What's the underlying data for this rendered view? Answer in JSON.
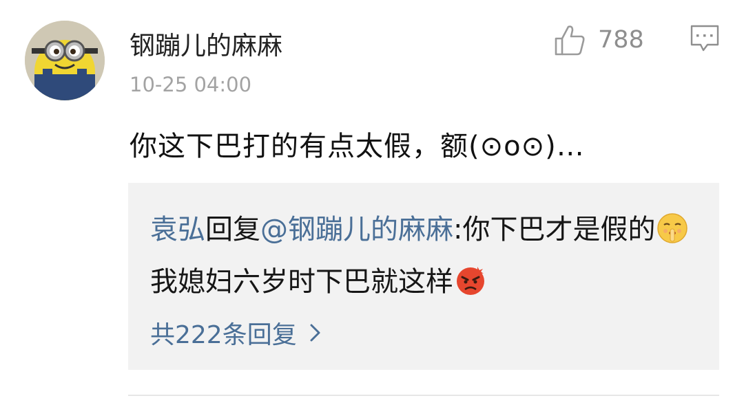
{
  "comment": {
    "username": "钢蹦儿的麻麻",
    "timestamp": "10-25 04:00",
    "like_count": "788",
    "text": "你这下巴打的有点太假，额(⊙o⊙)…",
    "icons": {
      "avatar": "minion-avatar",
      "like": "thumbs-up-icon",
      "reply": "comment-bubble-icon"
    }
  },
  "reply": {
    "author": "袁弘",
    "reply_word": "回复",
    "mention": "@钢蹦儿的麻麻",
    "text_part1": ":你下巴才是假的",
    "emoji1": "shush-emoji",
    "text_part2": "我媳妇六岁时下巴就这样",
    "emoji2": "angry-emoji",
    "more_label": "共222条回复"
  },
  "colors": {
    "link": "#4a6f97",
    "meta": "#a3a3a3",
    "reply_bg": "#f2f2f2"
  }
}
